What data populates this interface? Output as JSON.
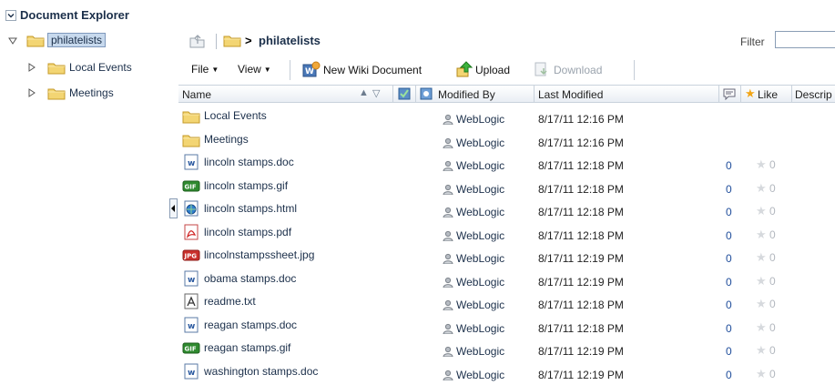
{
  "header": {
    "title": "Document Explorer"
  },
  "tree": {
    "root": "philatelists",
    "children": [
      "Local Events",
      "Meetings"
    ]
  },
  "breadcrumb": {
    "separator": ">",
    "current": "philatelists"
  },
  "filter": {
    "label": "Filter",
    "value": ""
  },
  "toolbar": {
    "file": "File",
    "view": "View",
    "new_wiki": "New Wiki Document",
    "upload": "Upload",
    "download": "Download"
  },
  "columns": {
    "name": "Name",
    "modified_by": "Modified By",
    "last_modified": "Last Modified",
    "like": "Like",
    "description": "Descrip"
  },
  "rows": [
    {
      "name": "Local Events",
      "type": "folder",
      "modified_by": "WebLogic",
      "date": "8/17/11 12:16 PM",
      "comments": "",
      "likes": ""
    },
    {
      "name": "Meetings",
      "type": "folder",
      "modified_by": "WebLogic",
      "date": "8/17/11 12:16 PM",
      "comments": "",
      "likes": ""
    },
    {
      "name": "lincoln stamps.doc",
      "type": "doc",
      "modified_by": "WebLogic",
      "date": "8/17/11 12:18 PM",
      "comments": "0",
      "likes": "0"
    },
    {
      "name": "lincoln stamps.gif",
      "type": "gif",
      "modified_by": "WebLogic",
      "date": "8/17/11 12:18 PM",
      "comments": "0",
      "likes": "0"
    },
    {
      "name": "lincoln stamps.html",
      "type": "html",
      "modified_by": "WebLogic",
      "date": "8/17/11 12:18 PM",
      "comments": "0",
      "likes": "0"
    },
    {
      "name": "lincoln stamps.pdf",
      "type": "pdf",
      "modified_by": "WebLogic",
      "date": "8/17/11 12:18 PM",
      "comments": "0",
      "likes": "0"
    },
    {
      "name": "lincolnstampssheet.jpg",
      "type": "jpg",
      "modified_by": "WebLogic",
      "date": "8/17/11 12:19 PM",
      "comments": "0",
      "likes": "0"
    },
    {
      "name": "obama stamps.doc",
      "type": "doc",
      "modified_by": "WebLogic",
      "date": "8/17/11 12:19 PM",
      "comments": "0",
      "likes": "0"
    },
    {
      "name": "readme.txt",
      "type": "txt",
      "modified_by": "WebLogic",
      "date": "8/17/11 12:18 PM",
      "comments": "0",
      "likes": "0"
    },
    {
      "name": "reagan stamps.doc",
      "type": "doc",
      "modified_by": "WebLogic",
      "date": "8/17/11 12:18 PM",
      "comments": "0",
      "likes": "0"
    },
    {
      "name": "reagan stamps.gif",
      "type": "gif",
      "modified_by": "WebLogic",
      "date": "8/17/11 12:19 PM",
      "comments": "0",
      "likes": "0"
    },
    {
      "name": "washington stamps.doc",
      "type": "doc",
      "modified_by": "WebLogic",
      "date": "8/17/11 12:19 PM",
      "comments": "0",
      "likes": "0"
    }
  ]
}
